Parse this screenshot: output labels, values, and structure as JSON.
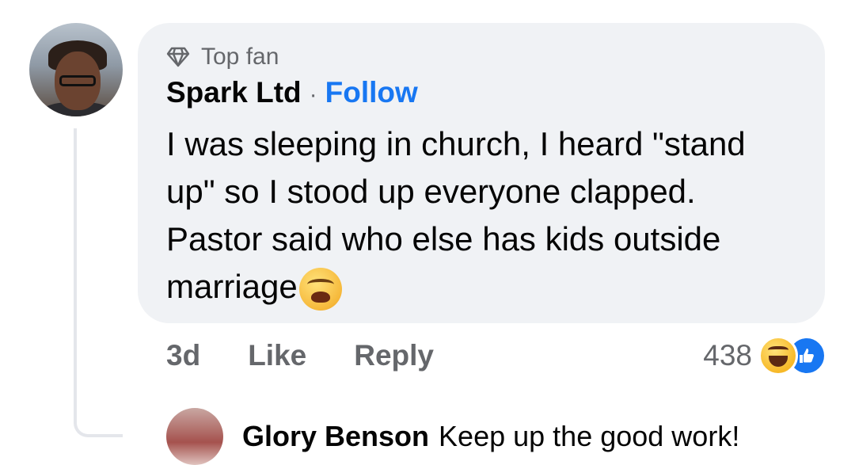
{
  "comment": {
    "badge": "Top fan",
    "author": "Spark Ltd",
    "separator": "·",
    "follow_label": "Follow",
    "text": "I was sleeping in church, I heard \"stand up\" so I stood up everyone clapped. Pastor said who else has kids outside marriage",
    "emoji_icon": "weary-face-emoji"
  },
  "actions": {
    "time": "3d",
    "like_label": "Like",
    "reply_label": "Reply"
  },
  "reactions": {
    "count": "438",
    "types": [
      "haha",
      "like"
    ]
  },
  "reply": {
    "author": "Glory Benson",
    "text": "Keep up the good work!"
  },
  "colors": {
    "accent": "#1877f2",
    "bubble": "#f0f2f5",
    "muted": "#65676b"
  }
}
